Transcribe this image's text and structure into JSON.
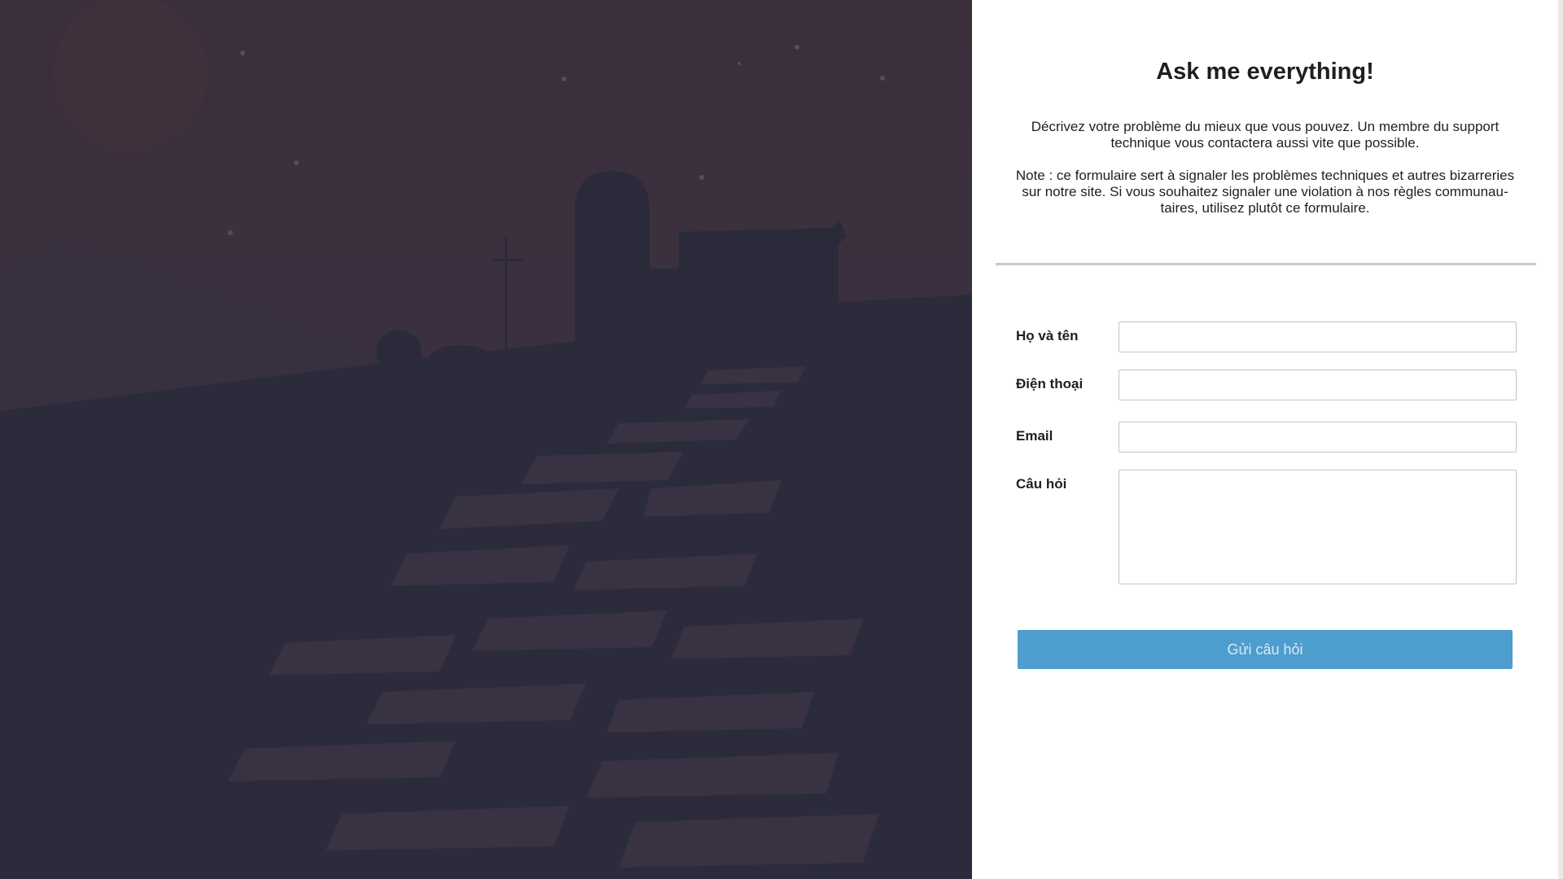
{
  "form": {
    "title": "Ask me everything!",
    "description": "Décrivez votre problème du mieux que vous pouvez. Un membre du support technique vous contactera aussi vite que possible.",
    "note": "Note : ce formulaire sert à signaler les problèmes techniques et autres bizarreries sur notre site. Si vous souhaitez signaler une violation à nos règles communau-taires, utilisez plutôt ce formulaire.",
    "fields": {
      "name": {
        "label": "Họ và tên",
        "value": ""
      },
      "phone": {
        "label": "Điện thoại",
        "value": ""
      },
      "email": {
        "label": "Email",
        "value": ""
      },
      "question": {
        "label": "Câu hỏi",
        "value": ""
      }
    },
    "submit_label": "Gửi câu hỏi"
  },
  "colors": {
    "sky": "#3a2f3d",
    "ground": "#2a2a3a",
    "accent": "#4e9dcf",
    "panel": "#ffffff"
  }
}
